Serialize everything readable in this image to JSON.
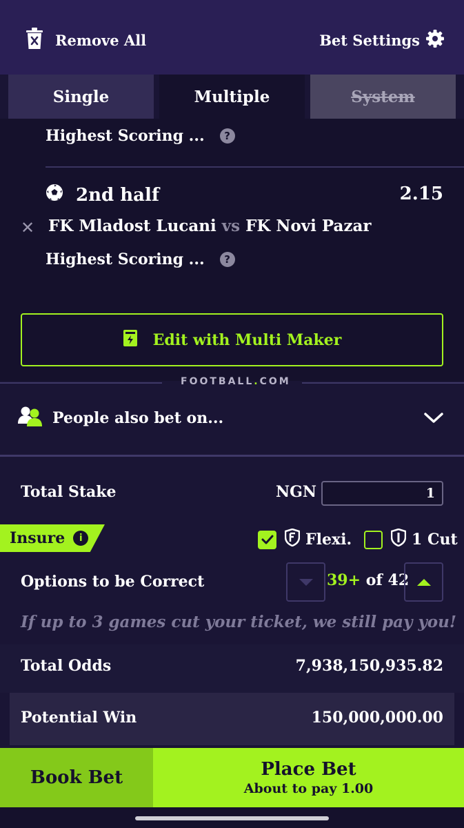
{
  "header": {
    "remove_all_label": "Remove All",
    "bet_settings_label": "Bet Settings"
  },
  "tabs": [
    {
      "label": "Single",
      "state": "inactive"
    },
    {
      "label": "Multiple",
      "state": "active"
    },
    {
      "label": "System",
      "state": "disabled"
    }
  ],
  "bets": [
    {
      "market": "Highest Scoring ..."
    },
    {
      "selection": "2nd half",
      "odds": "2.15",
      "home": "FK Mladost Lucani",
      "vs": "vs",
      "away": "FK Novi Pazar",
      "market": "Highest Scoring ..."
    }
  ],
  "multi_maker_label": "Edit with Multi Maker",
  "brand": {
    "left": "FOOTBALL",
    "dot": ".",
    "right": "COM"
  },
  "people_also_bet_label": "People also bet on...",
  "stake": {
    "label": "Total Stake",
    "currency": "NGN",
    "value": "1"
  },
  "insure": {
    "label": "Insure",
    "flexi_label": "Flexi.",
    "flexi_checked": true,
    "one_cut_label": "1 Cut",
    "one_cut_checked": false
  },
  "options_correct": {
    "label": "Options to be Correct",
    "value": "39+",
    "of_text": "of 42"
  },
  "guarantee_text": "If up to 3 games cut your ticket, we still pay you!",
  "totals": {
    "odds_label": "Total Odds",
    "odds_value": "7,938,150,935.82",
    "win_label": "Potential Win",
    "win_value": "150,000,000.00"
  },
  "footer": {
    "book_label": "Book Bet",
    "place_label": "Place Bet",
    "place_sub": "About to pay 1.00"
  },
  "colors": {
    "accent": "#a3f21f",
    "background": "#1a1535",
    "header": "#2a1f55"
  }
}
